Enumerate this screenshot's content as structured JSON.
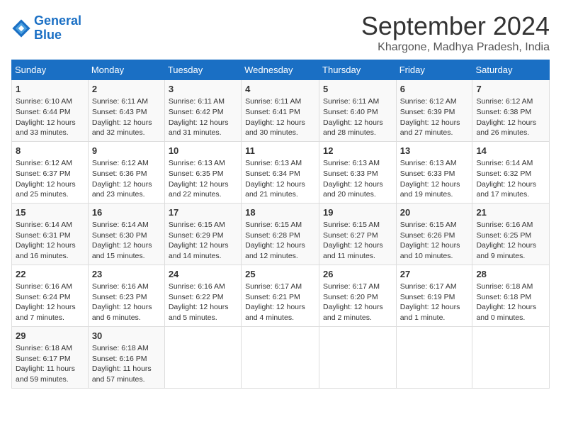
{
  "logo": {
    "line1": "General",
    "line2": "Blue"
  },
  "title": "September 2024",
  "subtitle": "Khargone, Madhya Pradesh, India",
  "days_of_week": [
    "Sunday",
    "Monday",
    "Tuesday",
    "Wednesday",
    "Thursday",
    "Friday",
    "Saturday"
  ],
  "weeks": [
    [
      {
        "day": 1,
        "info": "Sunrise: 6:10 AM\nSunset: 6:44 PM\nDaylight: 12 hours\nand 33 minutes."
      },
      {
        "day": 2,
        "info": "Sunrise: 6:11 AM\nSunset: 6:43 PM\nDaylight: 12 hours\nand 32 minutes."
      },
      {
        "day": 3,
        "info": "Sunrise: 6:11 AM\nSunset: 6:42 PM\nDaylight: 12 hours\nand 31 minutes."
      },
      {
        "day": 4,
        "info": "Sunrise: 6:11 AM\nSunset: 6:41 PM\nDaylight: 12 hours\nand 30 minutes."
      },
      {
        "day": 5,
        "info": "Sunrise: 6:11 AM\nSunset: 6:40 PM\nDaylight: 12 hours\nand 28 minutes."
      },
      {
        "day": 6,
        "info": "Sunrise: 6:12 AM\nSunset: 6:39 PM\nDaylight: 12 hours\nand 27 minutes."
      },
      {
        "day": 7,
        "info": "Sunrise: 6:12 AM\nSunset: 6:38 PM\nDaylight: 12 hours\nand 26 minutes."
      }
    ],
    [
      {
        "day": 8,
        "info": "Sunrise: 6:12 AM\nSunset: 6:37 PM\nDaylight: 12 hours\nand 25 minutes."
      },
      {
        "day": 9,
        "info": "Sunrise: 6:12 AM\nSunset: 6:36 PM\nDaylight: 12 hours\nand 23 minutes."
      },
      {
        "day": 10,
        "info": "Sunrise: 6:13 AM\nSunset: 6:35 PM\nDaylight: 12 hours\nand 22 minutes."
      },
      {
        "day": 11,
        "info": "Sunrise: 6:13 AM\nSunset: 6:34 PM\nDaylight: 12 hours\nand 21 minutes."
      },
      {
        "day": 12,
        "info": "Sunrise: 6:13 AM\nSunset: 6:33 PM\nDaylight: 12 hours\nand 20 minutes."
      },
      {
        "day": 13,
        "info": "Sunrise: 6:13 AM\nSunset: 6:33 PM\nDaylight: 12 hours\nand 19 minutes."
      },
      {
        "day": 14,
        "info": "Sunrise: 6:14 AM\nSunset: 6:32 PM\nDaylight: 12 hours\nand 17 minutes."
      }
    ],
    [
      {
        "day": 15,
        "info": "Sunrise: 6:14 AM\nSunset: 6:31 PM\nDaylight: 12 hours\nand 16 minutes."
      },
      {
        "day": 16,
        "info": "Sunrise: 6:14 AM\nSunset: 6:30 PM\nDaylight: 12 hours\nand 15 minutes."
      },
      {
        "day": 17,
        "info": "Sunrise: 6:15 AM\nSunset: 6:29 PM\nDaylight: 12 hours\nand 14 minutes."
      },
      {
        "day": 18,
        "info": "Sunrise: 6:15 AM\nSunset: 6:28 PM\nDaylight: 12 hours\nand 12 minutes."
      },
      {
        "day": 19,
        "info": "Sunrise: 6:15 AM\nSunset: 6:27 PM\nDaylight: 12 hours\nand 11 minutes."
      },
      {
        "day": 20,
        "info": "Sunrise: 6:15 AM\nSunset: 6:26 PM\nDaylight: 12 hours\nand 10 minutes."
      },
      {
        "day": 21,
        "info": "Sunrise: 6:16 AM\nSunset: 6:25 PM\nDaylight: 12 hours\nand 9 minutes."
      }
    ],
    [
      {
        "day": 22,
        "info": "Sunrise: 6:16 AM\nSunset: 6:24 PM\nDaylight: 12 hours\nand 7 minutes."
      },
      {
        "day": 23,
        "info": "Sunrise: 6:16 AM\nSunset: 6:23 PM\nDaylight: 12 hours\nand 6 minutes."
      },
      {
        "day": 24,
        "info": "Sunrise: 6:16 AM\nSunset: 6:22 PM\nDaylight: 12 hours\nand 5 minutes."
      },
      {
        "day": 25,
        "info": "Sunrise: 6:17 AM\nSunset: 6:21 PM\nDaylight: 12 hours\nand 4 minutes."
      },
      {
        "day": 26,
        "info": "Sunrise: 6:17 AM\nSunset: 6:20 PM\nDaylight: 12 hours\nand 2 minutes."
      },
      {
        "day": 27,
        "info": "Sunrise: 6:17 AM\nSunset: 6:19 PM\nDaylight: 12 hours\nand 1 minute."
      },
      {
        "day": 28,
        "info": "Sunrise: 6:18 AM\nSunset: 6:18 PM\nDaylight: 12 hours\nand 0 minutes."
      }
    ],
    [
      {
        "day": 29,
        "info": "Sunrise: 6:18 AM\nSunset: 6:17 PM\nDaylight: 11 hours\nand 59 minutes."
      },
      {
        "day": 30,
        "info": "Sunrise: 6:18 AM\nSunset: 6:16 PM\nDaylight: 11 hours\nand 57 minutes."
      },
      null,
      null,
      null,
      null,
      null
    ]
  ]
}
